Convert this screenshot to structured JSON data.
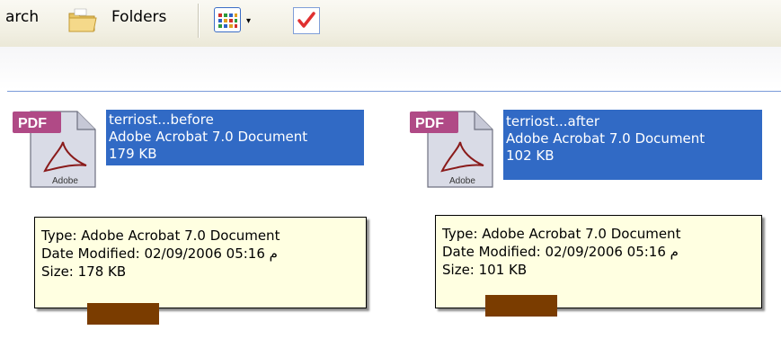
{
  "toolbar": {
    "search_label": "arch",
    "folders_label": "Folders",
    "views_arrow": "▾"
  },
  "files": [
    {
      "name": "terriost...before",
      "type_line": "Adobe Acrobat 7.0 Document",
      "size_line": "179 KB",
      "icon_badge": "PDF",
      "icon_caption": "Adobe",
      "tooltip": {
        "type": "Type: Adobe Acrobat 7.0 Document",
        "date": "Date Modified: 02/09/2006 05:16 م",
        "size": "Size: 178 KB"
      }
    },
    {
      "name": "terriost...after",
      "type_line": "Adobe Acrobat 7.0 Document",
      "size_line": "102 KB",
      "icon_badge": "PDF",
      "icon_caption": "Adobe",
      "tooltip": {
        "type": "Type: Adobe Acrobat 7.0 Document",
        "date": "Date Modified: 02/09/2006 05:16 م",
        "size": "Size: 101 KB"
      }
    }
  ],
  "colors": {
    "selection": "#316ac5",
    "tooltip_bg": "#ffffe1",
    "redaction": "#7a3c00",
    "pdf_badge": "#b04a86"
  }
}
